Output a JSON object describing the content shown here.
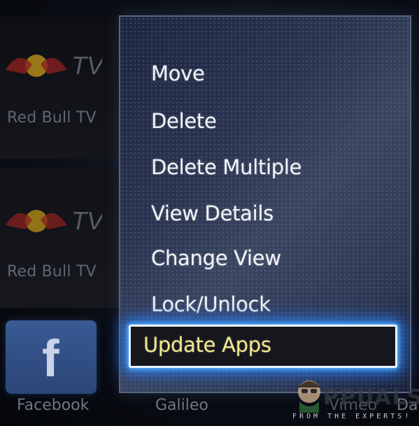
{
  "background_tiles": [
    {
      "label": "Red Bull TV"
    },
    {
      "label": "Red Bull TV"
    }
  ],
  "bottom_row": {
    "facebook_label": "Facebook",
    "galileo_label": "Galileo",
    "vimeo_label": "Vimeo",
    "dai_label": "Dai"
  },
  "context_menu": {
    "items": [
      {
        "label": "Move"
      },
      {
        "label": "Delete"
      },
      {
        "label": "Delete Multiple"
      },
      {
        "label": "View Details"
      },
      {
        "label": "Change View"
      },
      {
        "label": "Lock/Unlock"
      }
    ],
    "selected": {
      "label": "Update Apps"
    }
  },
  "watermark": {
    "brand_letters": "PPUALS",
    "tagline": "FROM THE EXPERTS!"
  },
  "icons": {
    "redbull_logo": "red-bull-tv-logo",
    "facebook_logo": "facebook-f-icon",
    "watermark_mascot": "appuals-mascot-icon"
  },
  "colors": {
    "menu_text": "#f2f4f8",
    "selected_text": "#f3e88c",
    "selected_glow": "#3c8cff",
    "facebook_blue": "#3a5a94"
  }
}
